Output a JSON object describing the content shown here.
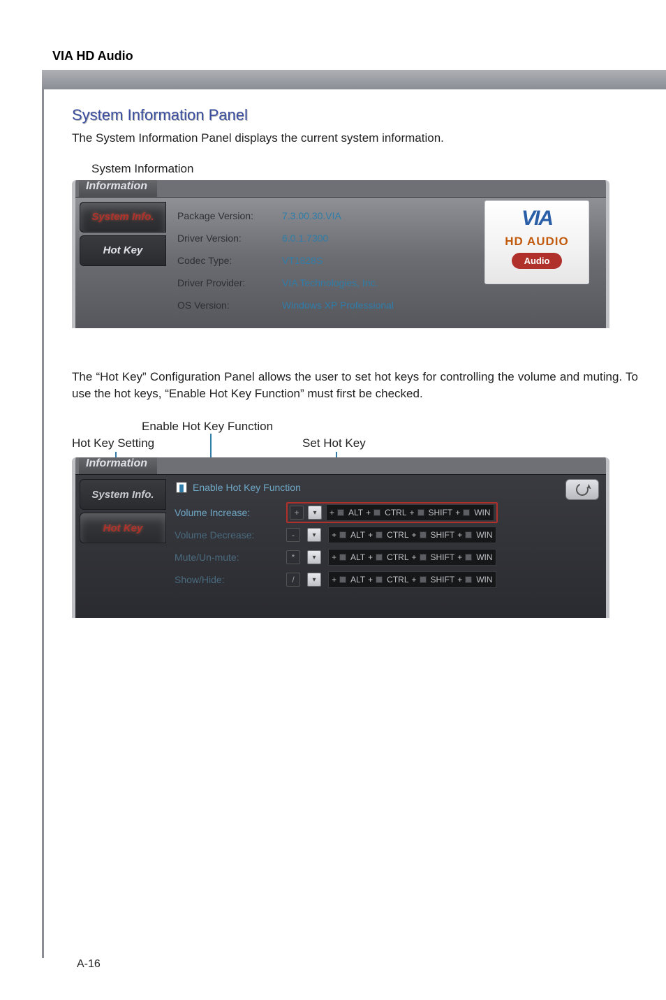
{
  "page": {
    "top_heading": "VIA HD Audio",
    "page_number": "A-16"
  },
  "section1": {
    "title": "System Information Panel",
    "description": "The System Information Panel displays the current system information.",
    "caption": "System Information"
  },
  "sysinfo_panel": {
    "top_tab": "Information",
    "tabs": {
      "system_info": "System Info.",
      "hot_key": "Hot Key"
    },
    "rows": [
      {
        "label": "Package Version:",
        "value": "7.3.00.30.VIA"
      },
      {
        "label": "Driver Version:",
        "value": "6.0.1.7300"
      },
      {
        "label": "Codec Type:",
        "value": "VT1828S"
      },
      {
        "label": "Driver Provider:",
        "value": "VIA Technologies, Inc."
      },
      {
        "label": "OS Version:",
        "value": "Windows XP  Professional"
      }
    ],
    "logo": {
      "brand": "VIA",
      "hd": "HD AUDIO",
      "pill": "Audio"
    }
  },
  "hotkey_desc": "The “Hot Key” Configuration Panel allows the user to set hot keys for controlling the volume and muting. To use the hot keys, “Enable Hot Key Function” must first be checked.",
  "annotations": {
    "hot_key_setting": "Hot Key Setting",
    "enable": "Enable Hot Key Function",
    "set": "Set Hot Key"
  },
  "hotkey_panel": {
    "top_tab": "Information",
    "tabs": {
      "system_info": "System Info.",
      "hot_key": "Hot Key"
    },
    "enable_label": "Enable Hot Key Function",
    "rows": [
      {
        "label": "Volume Increase:",
        "key": "+"
      },
      {
        "label": "Volume Decrease:",
        "key": "-"
      },
      {
        "label": "Mute/Un-mute:",
        "key": "*"
      },
      {
        "label": "Show/Hide:",
        "key": "/"
      }
    ],
    "modifiers": [
      "ALT",
      "CTRL",
      "SHIFT",
      "WIN"
    ]
  }
}
